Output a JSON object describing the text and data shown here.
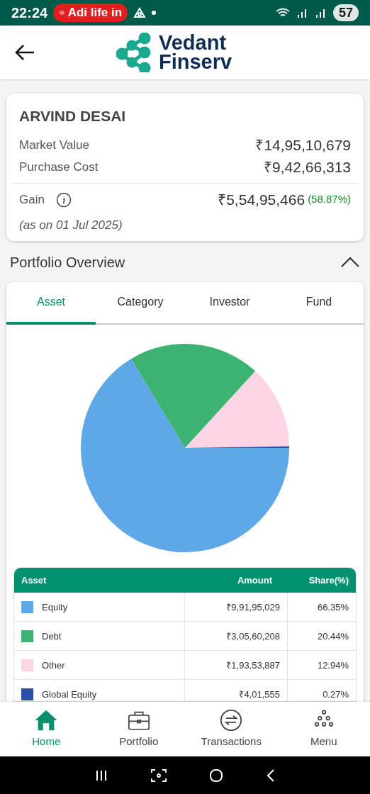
{
  "status_bar": {
    "time": "22:24",
    "call_chip": "Adi life in",
    "battery": "57"
  },
  "header": {
    "logo_line1": "Vedant",
    "logo_line2": "Finserv"
  },
  "summary": {
    "name": "ARVIND DESAI",
    "rows": [
      {
        "label": "Market Value",
        "value": "₹14,95,10,679"
      },
      {
        "label": "Purchase Cost",
        "value": "₹9,42,66,313"
      }
    ],
    "gain": {
      "label": "Gain",
      "value": "₹5,54,95,466",
      "percent": "(58.87%)"
    },
    "as_on": "(as on 01 Jul 2025)"
  },
  "overview": {
    "title": "Portfolio Overview",
    "expanded": true,
    "tabs": [
      {
        "label": "Asset",
        "selected": true
      },
      {
        "label": "Category",
        "selected": false
      },
      {
        "label": "Investor",
        "selected": false
      },
      {
        "label": "Fund",
        "selected": false
      }
    ],
    "chart_data": {
      "type": "pie",
      "values": [
        66.35,
        20.44,
        12.94,
        0.27
      ]
    },
    "table": {
      "columns": [
        "Asset",
        "Amount",
        "Share(%)"
      ],
      "rows": [
        {
          "asset": "Equity",
          "color": "#5ea8e8",
          "amount": "₹9,91,95,029",
          "share": "66.35%"
        },
        {
          "asset": "Debt",
          "color": "#3cb371",
          "amount": "₹3,05,60,208",
          "share": "20.44%"
        },
        {
          "asset": "Other",
          "color": "#fdd5e6",
          "amount": "₹1,93,53,887",
          "share": "12.94%"
        },
        {
          "asset": "Global Equity",
          "color": "#2a4fad",
          "amount": "₹4,01,555",
          "share": "0.27%"
        }
      ]
    }
  },
  "bottom_nav": [
    {
      "label": "Home",
      "kind": "home",
      "selected": true
    },
    {
      "label": "Portfolio",
      "kind": "briefcase",
      "selected": false
    },
    {
      "label": "Transactions",
      "kind": "exchange",
      "selected": false
    },
    {
      "label": "Menu",
      "kind": "dots",
      "selected": false
    }
  ]
}
